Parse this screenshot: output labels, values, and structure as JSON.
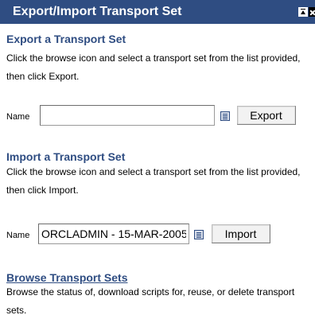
{
  "portlet": {
    "title": "Export/Import Transport Set",
    "header_buttons": [
      {
        "name": "move-up-icon"
      },
      {
        "name": "close-icon"
      }
    ]
  },
  "export_section": {
    "title": "Export a Transport Set",
    "description": "Click the browse icon and select a transport set from the list provided, then click Export.",
    "name_label": "Name",
    "name_value": "",
    "browse_icon": "browse-list-icon",
    "button_label": "Export"
  },
  "import_section": {
    "title": "Import a Transport Set",
    "description": "Click the browse icon and select a transport set from the list provided, then click Import.",
    "name_label": "Name",
    "name_value": "ORCLADMIN - 15-MAR-2005",
    "browse_icon": "browse-list-icon",
    "button_label": "Import"
  },
  "browse_section": {
    "title": "Browse Transport Sets",
    "description": "Browse the status of, download scripts for, reuse, or delete transport sets."
  },
  "colors": {
    "header_bg": "#2f4d82",
    "section_title": "#2f4d82"
  }
}
